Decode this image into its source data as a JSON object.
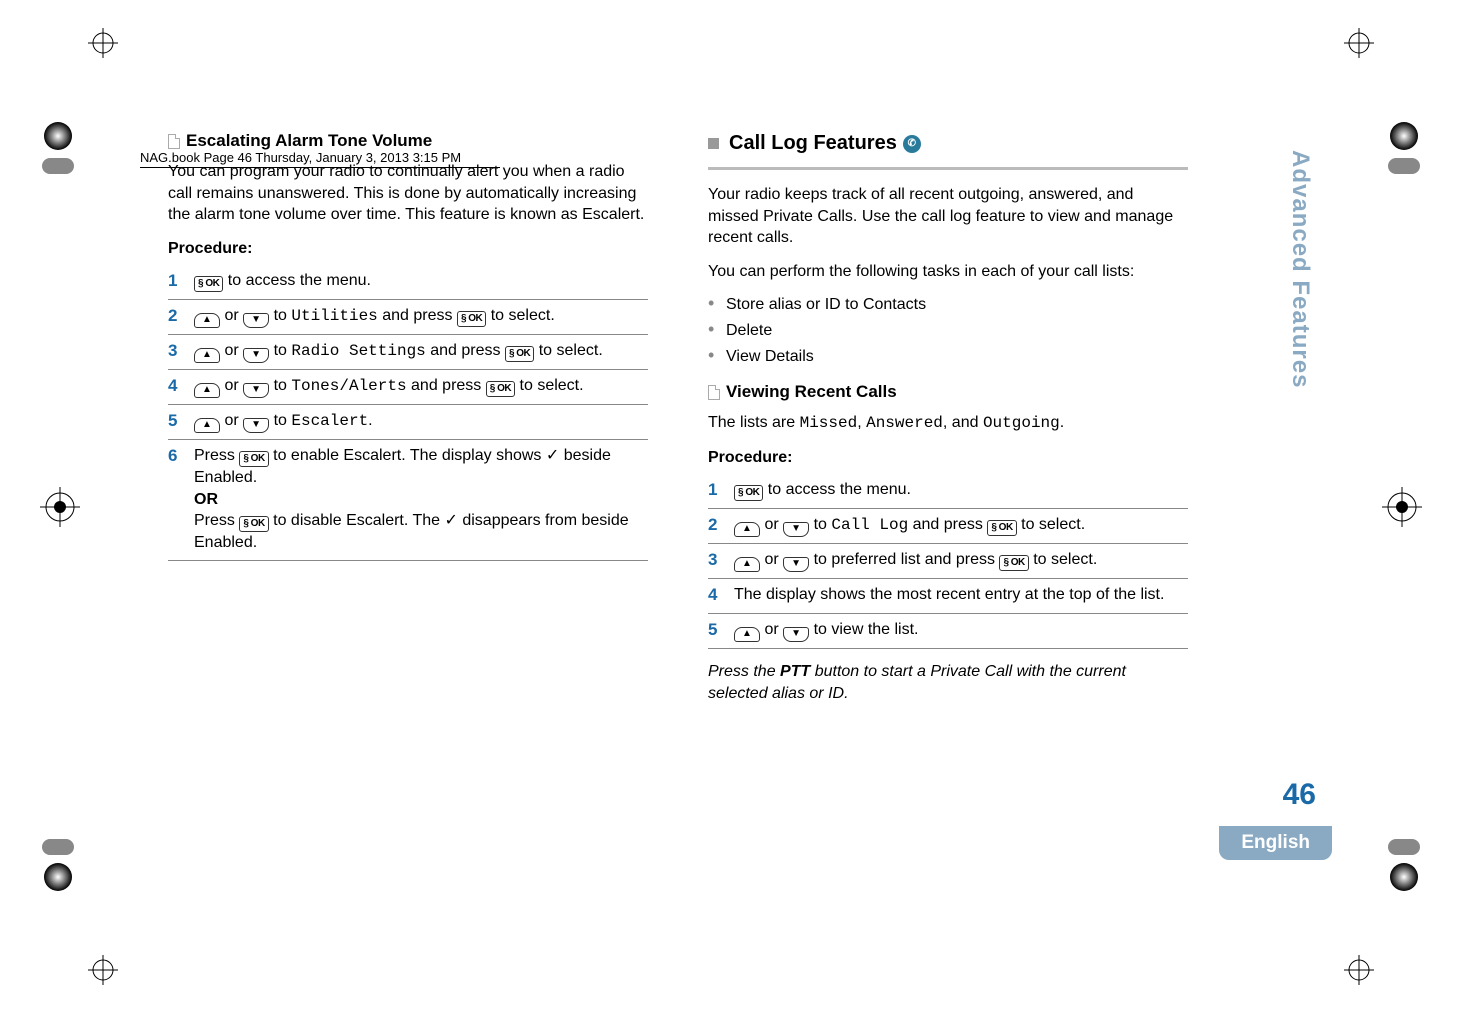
{
  "header": "NAG.book  Page 46  Thursday, January 3, 2013  3:15 PM",
  "left": {
    "h1": "Escalating Alarm Tone Volume",
    "intro": "You can program your radio to continually alert you when a radio call remains unanswered. This is done by automatically increasing the alarm tone volume over time. This feature is known as Escalert.",
    "proc_label": "Procedure:",
    "steps": [
      {
        "n": "1",
        "pre": "",
        "post": " to access the menu.",
        "type": "ok"
      },
      {
        "n": "2",
        "mid": " to ",
        "mono": "Utilities",
        "post2": " and press ",
        "post3": " to select.",
        "type": "arrows_ok"
      },
      {
        "n": "3",
        "mid": " to ",
        "mono": "Radio Settings",
        "post2": " and press ",
        "post3": " to select.",
        "type": "arrows_ok"
      },
      {
        "n": "4",
        "mid": " to ",
        "mono": "Tones/Alerts",
        "post2": " and press ",
        "post3": " to select.",
        "type": "arrows_ok"
      },
      {
        "n": "5",
        "mid": " to ",
        "mono": "Escalert",
        "post2": ".",
        "type": "arrows"
      },
      {
        "n": "6",
        "l1a": "Press ",
        "l1b": " to enable Escalert. The display shows ✓ beside Enabled.",
        "or": "OR",
        "l2a": "Press ",
        "l2b": " to disable Escalert. The ✓ disappears from beside Enabled.",
        "type": "six"
      }
    ]
  },
  "right": {
    "h1": "Call Log Features",
    "intro": "Your radio keeps track of all recent outgoing, answered, and missed Private Calls. Use the call log feature to view and manage recent calls.",
    "intro2": "You can perform the following tasks in each of your call lists:",
    "bullets": [
      "Store alias or ID to Contacts",
      "Delete",
      "View Details"
    ],
    "h2": "Viewing Recent Calls",
    "lists_pre": "The lists are ",
    "lists": "Missed",
    "lists_sep1": ", ",
    "lists2": "Answered",
    "lists_sep2": ", and ",
    "lists3": "Outgoing",
    "lists_post": ".",
    "proc_label": "Procedure:",
    "steps": [
      {
        "n": "1",
        "post": " to access the menu.",
        "type": "ok"
      },
      {
        "n": "2",
        "mid": " to ",
        "mono": "Call Log",
        "post2": " and press ",
        "post3": " to select.",
        "type": "arrows_ok"
      },
      {
        "n": "3",
        "mid": " to preferred list and press ",
        "post3": " to select.",
        "type": "arrows_ok_plain"
      },
      {
        "n": "4",
        "text": "The display shows the most recent entry at the top of the list.",
        "type": "plain"
      },
      {
        "n": "5",
        "mid": " to view the list.",
        "type": "arrows_plain"
      }
    ],
    "footnote_pre": "Press the ",
    "footnote_bold": "PTT",
    "footnote_post": " button to start a Private Call with the current selected alias or ID."
  },
  "sidebar": {
    "title": "Advanced Features",
    "page": "46",
    "lang": "English"
  },
  "icons": {
    "ok": "§ OK",
    "up": "▲",
    "down": "▼",
    "or": " or ",
    "phone": "✆"
  }
}
